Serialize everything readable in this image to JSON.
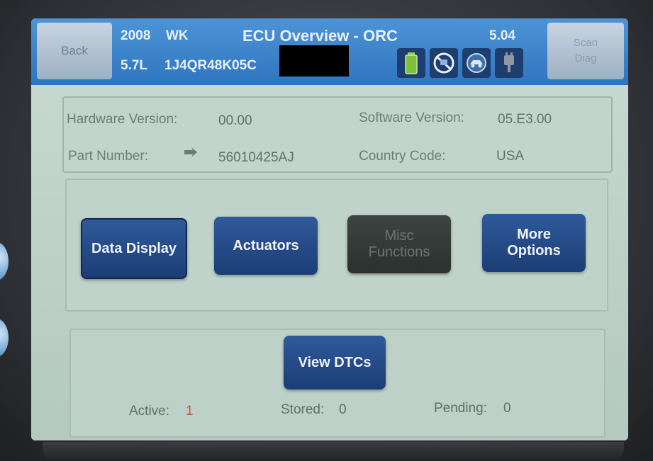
{
  "header": {
    "title": "ECU Overview - ORC",
    "year": "2008",
    "model": "WK",
    "engine": "5.7L",
    "vin": "1J4QR48K05C",
    "version": "5.04",
    "back_label": "Back",
    "right_button": [
      "Scan",
      "Diag"
    ],
    "status_icons": [
      "battery-icon",
      "no-connection-icon",
      "vehicle-link-icon",
      "plug-icon"
    ]
  },
  "ecu_info": {
    "hardware_version_label": "Hardware Version:",
    "hardware_version_value": "00.00",
    "software_version_label": "Software Version:",
    "software_version_value": "05.E3.00",
    "part_number_label": "Part Number:",
    "part_number_value": "56010425AJ",
    "country_code_label": "Country Code:",
    "country_code_value": "USA"
  },
  "buttons": {
    "data_display": "Data Display",
    "actuators": "Actuators",
    "misc_functions": [
      "Misc",
      "Functions"
    ],
    "more_options": [
      "More",
      "Options"
    ]
  },
  "dtc": {
    "view_label": "View DTCs",
    "active_label": "Active:",
    "active_count": "1",
    "stored_label": "Stored:",
    "stored_count": "0",
    "pending_label": "Pending:",
    "pending_count": "0"
  },
  "colors": {
    "header": "#2f74c0",
    "button": "#1c3d75",
    "screen": "#bfd2c9",
    "active_alert": "#c25a3a"
  }
}
